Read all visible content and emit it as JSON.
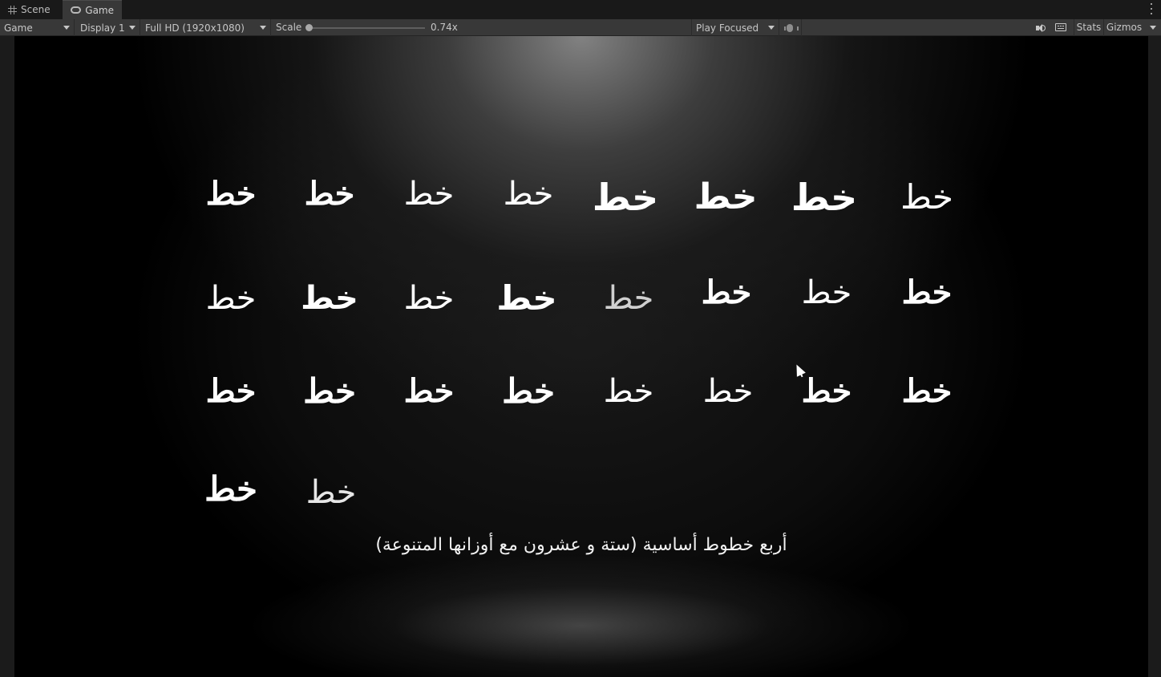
{
  "tabs": {
    "scene_label": "Scene",
    "game_label": "Game"
  },
  "toolbar": {
    "view_mode": "Game",
    "display": "Display 1",
    "resolution": "Full HD (1920x1080)",
    "scale_label": "Scale",
    "scale_value": "0.74x",
    "scale_fraction": 0.0,
    "play_mode": "Play Focused",
    "stats_label": "Stats",
    "gizmos_label": "Gizmos"
  },
  "game": {
    "sample_word": "خط",
    "caption": "أربع خطوط أساسية (ستة و عشرون مع أوزانها المتنوعة)",
    "rows": [
      [
        "خط",
        "خط",
        "خط",
        "خط",
        "خط",
        "خط",
        "خط",
        "خط"
      ],
      [
        "خط",
        "خط",
        "خط",
        "خط",
        "خط",
        "خط",
        "خط",
        "خط"
      ],
      [
        "خط",
        "خط",
        "خط",
        "خط",
        "خط",
        "خط",
        "خط",
        "خط"
      ],
      [
        "خط",
        "خط"
      ]
    ]
  },
  "icons": {
    "scene_tab": "grid-icon",
    "game_tab": "gamepad-icon",
    "debug": "bug-icon",
    "audio": "speaker-icon",
    "shortcuts": "keyboard-icon",
    "menu": "kebab-menu-icon"
  },
  "colors": {
    "editor_bg": "#191919",
    "toolbar_bg": "#383838",
    "game_bg": "#000000",
    "text": "#ffffff"
  }
}
